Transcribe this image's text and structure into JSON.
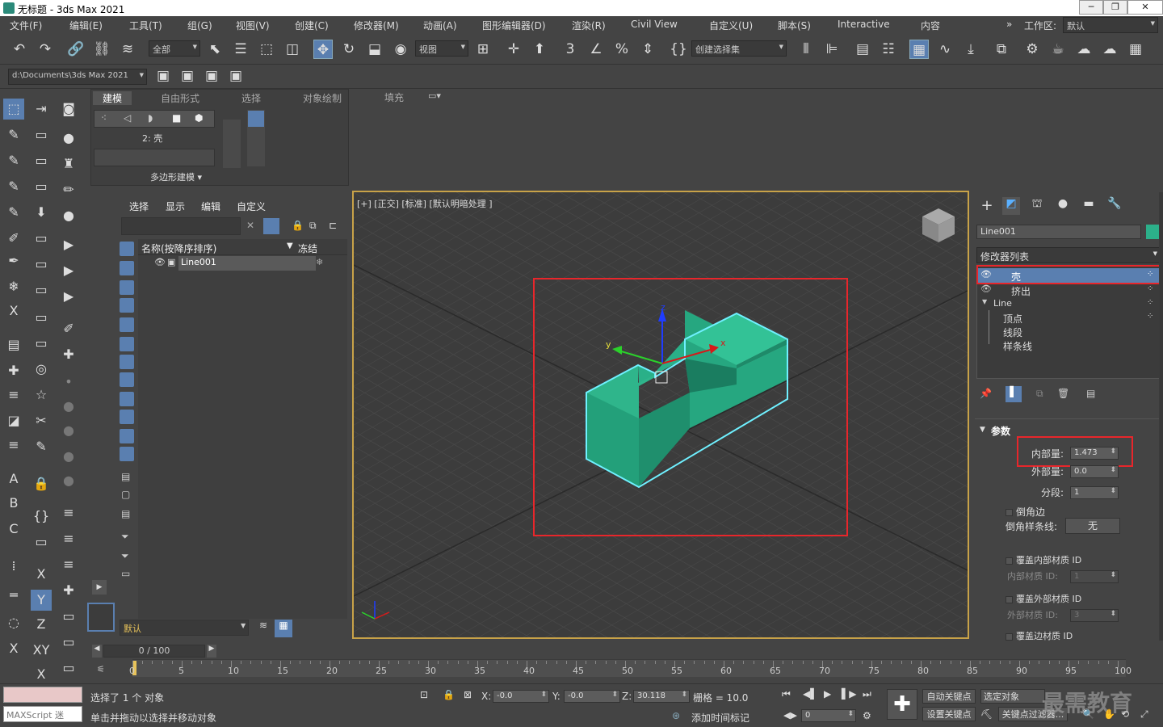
{
  "window": {
    "title": "无标题 - 3ds Max 2021",
    "min": "─",
    "max": "❐",
    "close": "✕"
  },
  "menu": [
    {
      "id": "file",
      "label": "文件(F)"
    },
    {
      "id": "edit",
      "label": "编辑(E)"
    },
    {
      "id": "tools",
      "label": "工具(T)"
    },
    {
      "id": "group",
      "label": "组(G)"
    },
    {
      "id": "views",
      "label": "视图(V)"
    },
    {
      "id": "create",
      "label": "创建(C)"
    },
    {
      "id": "modifiers",
      "label": "修改器(M)"
    },
    {
      "id": "animation",
      "label": "动画(A)"
    },
    {
      "id": "graph",
      "label": "图形编辑器(D)"
    },
    {
      "id": "render",
      "label": "渲染(R)"
    },
    {
      "id": "civil",
      "label": "Civil View"
    },
    {
      "id": "customize",
      "label": "自定义(U)"
    },
    {
      "id": "script",
      "label": "脚本(S)"
    },
    {
      "id": "interactive",
      "label": "Interactive"
    },
    {
      "id": "content",
      "label": "内容"
    }
  ],
  "workspace": {
    "label": "工作区:",
    "value": "默认",
    "chevron": "»"
  },
  "toolbar": {
    "filter": "全部",
    "refcoord": "视图",
    "selset": "创建选择集"
  },
  "project_path": "d:\\Documents\\3ds Max 2021",
  "ribbon": {
    "tabs": [
      "建模",
      "自由形式",
      "选择",
      "对象绘制",
      "填充"
    ],
    "level": "2: 壳",
    "panel": "多边形建模 ▾"
  },
  "explorer": {
    "menu": [
      "选择",
      "显示",
      "编辑",
      "自定义"
    ],
    "col_name": "名称(按降序排序)",
    "col_freeze": "冻结",
    "rows": [
      {
        "name": "Line001"
      }
    ],
    "layer": "默认"
  },
  "viewport": {
    "label": "[+] [正交] [标准] [默认明暗处理 ]"
  },
  "command_panel": {
    "object_name": "Line001",
    "modifier_list": "修改器列表",
    "stack": [
      {
        "label": "壳",
        "selected": true,
        "level": 0
      },
      {
        "label": "挤出",
        "selected": false,
        "level": 0
      },
      {
        "label": "Line",
        "selected": false,
        "level": 0,
        "expanded": true
      },
      {
        "label": "顶点",
        "selected": false,
        "level": 1
      },
      {
        "label": "线段",
        "selected": false,
        "level": 1
      },
      {
        "label": "样条线",
        "selected": false,
        "level": 1
      }
    ],
    "params_title": "参数",
    "inner_amount_label": "内部量:",
    "inner_amount": "1.473",
    "outer_amount_label": "外部量:",
    "outer_amount": "0.0",
    "segments_label": "分段:",
    "segments": "1",
    "bevel_edges": "倒角边",
    "bevel_spline_label": "倒角样条线:",
    "bevel_spline": "无",
    "override_inner": "覆盖内部材质 ID",
    "inner_mat_label": "内部材质 ID:",
    "inner_mat": "1",
    "override_outer": "覆盖外部材质 ID",
    "outer_mat_label": "外部材质 ID:",
    "outer_mat": "3",
    "override_edge": "覆盖边材质 ID"
  },
  "timeline": {
    "frame": "0 / 100",
    "ticks": [
      "0",
      "5",
      "10",
      "15",
      "20",
      "25",
      "30",
      "35",
      "40",
      "45",
      "50",
      "55",
      "60",
      "65",
      "70",
      "75",
      "80",
      "85",
      "90",
      "95",
      "100"
    ]
  },
  "status": {
    "selected": "选择了 1 个 对象",
    "hint": "单击并拖动以选择并移动对象",
    "maxscript": "MAXScript 迷",
    "x_label": "X:",
    "x": "-0.0",
    "y_label": "Y:",
    "y": "-0.0",
    "z_label": "Z:",
    "z": "30.118",
    "grid": "栅格 = 10.0",
    "add_time_tag": "添加时间标记",
    "autokey": "自动关键点",
    "selected_object": "选定对象",
    "set_key": "设置关键点",
    "key_filters": "关键点过滤器...",
    "frame_value": "0",
    "watermark": "最需教育"
  },
  "colors": {
    "accent": "#5a7fb0",
    "highlight": "#e8262b",
    "object": "#2cb08a",
    "viewport_border": "#c8a248"
  }
}
